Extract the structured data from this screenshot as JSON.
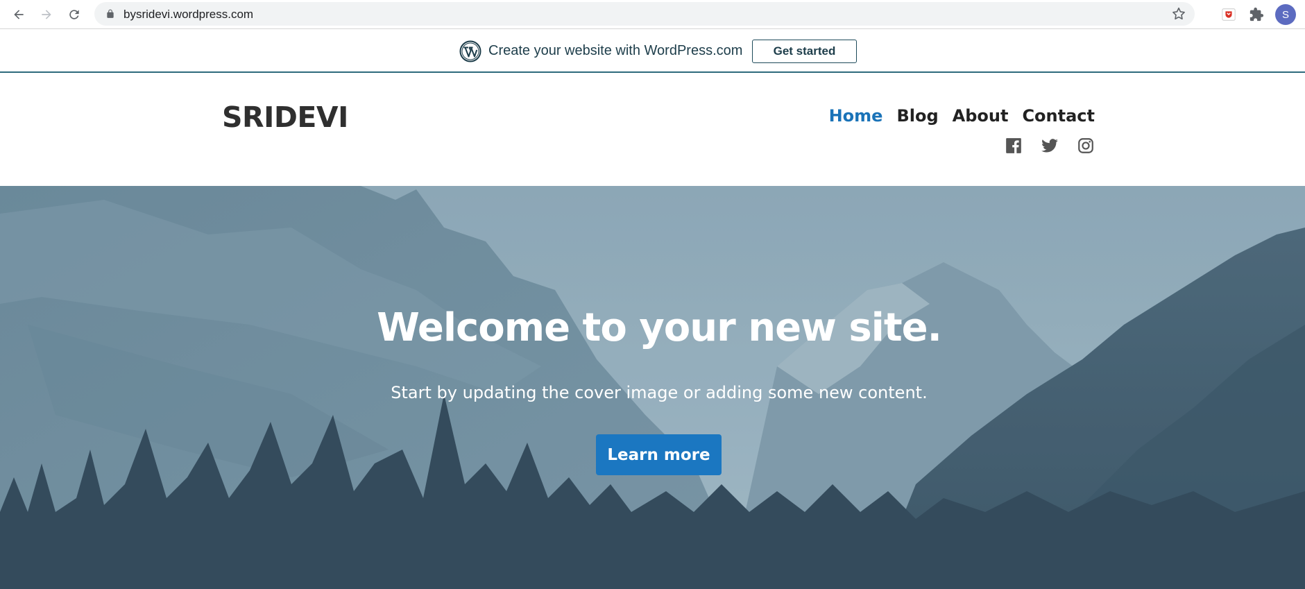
{
  "browser": {
    "url": "bysridevi.wordpress.com",
    "profile_initial": "S",
    "icons": [
      "back-icon",
      "forward-icon",
      "reload-icon",
      "lock-icon",
      "star-icon",
      "extension-icon",
      "puzzle-icon"
    ]
  },
  "promo": {
    "text": "Create your website with WordPress.com",
    "button": "Get started",
    "icon": "wordpress-logo-icon"
  },
  "site": {
    "title": "SRIDEVI",
    "menu": [
      {
        "label": "Home",
        "active": true
      },
      {
        "label": "Blog",
        "active": false
      },
      {
        "label": "About",
        "active": false
      },
      {
        "label": "Contact",
        "active": false
      }
    ],
    "social": [
      "facebook-icon",
      "twitter-icon",
      "instagram-icon"
    ]
  },
  "hero": {
    "title": "Welcome to your new site.",
    "subtitle": "Start by updating the cover image or adding some new content.",
    "button": "Learn more"
  },
  "colors": {
    "accent": "#1b77c1",
    "menu_active": "#1a73b8",
    "banner_border": "#2d6a7c",
    "avatar": "#5c6bc0"
  }
}
